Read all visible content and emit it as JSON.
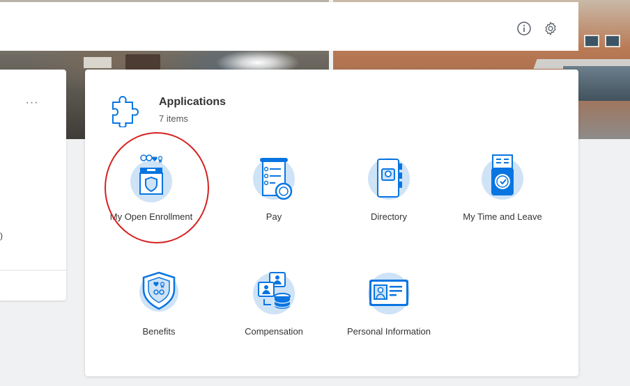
{
  "header": {
    "info_icon": "info-icon",
    "settings_icon": "gear-icon"
  },
  "left_card": {
    "more_label": "···",
    "cut_text": ")"
  },
  "applications": {
    "title": "Applications",
    "count": "7 items",
    "icon": "puzzle-icon",
    "items": [
      {
        "label": "My Open Enrollment",
        "icon": "enrollment-box-icon"
      },
      {
        "label": "Pay",
        "icon": "pay-receipt-icon"
      },
      {
        "label": "Directory",
        "icon": "directory-book-icon"
      },
      {
        "label": "My Time and Leave",
        "icon": "time-clock-icon"
      },
      {
        "label": "Benefits",
        "icon": "benefits-shield-icon"
      },
      {
        "label": "Compensation",
        "icon": "compensation-coins-icon"
      },
      {
        "label": "Personal Information",
        "icon": "id-card-icon"
      }
    ]
  },
  "colors": {
    "icon_blue": "#0875e1",
    "icon_light": "#cfe3f7",
    "highlight": "#d62020"
  }
}
